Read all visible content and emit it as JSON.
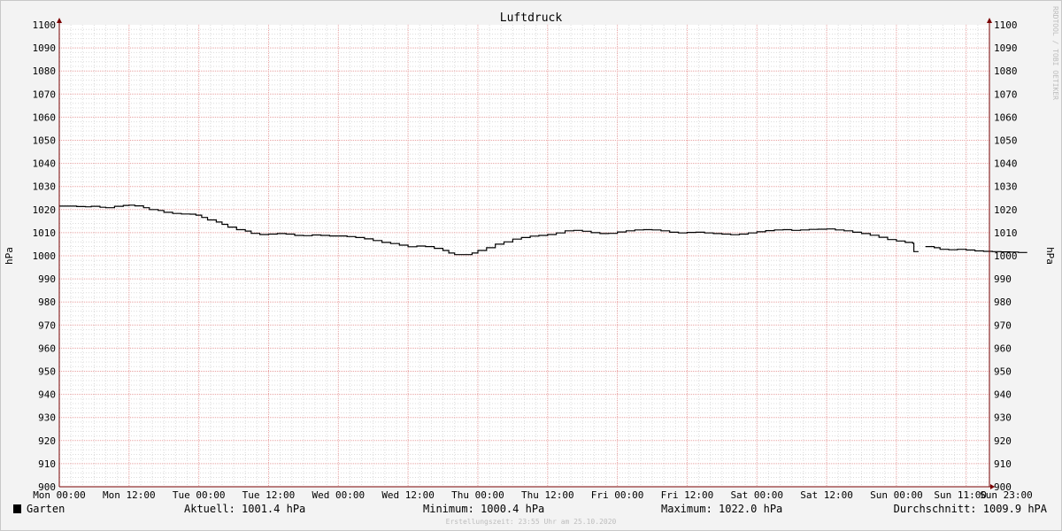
{
  "chart_data": {
    "type": "line",
    "title": "Luftdruck",
    "ylabel_left": "hPa",
    "ylabel_right": "hPa",
    "ylim": [
      900,
      1100
    ],
    "ytick_step": 10,
    "xlim_hours": [
      0,
      160
    ],
    "xticks": [
      {
        "h": 0,
        "label": "Mon 00:00"
      },
      {
        "h": 12,
        "label": "Mon 12:00"
      },
      {
        "h": 24,
        "label": "Tue 00:00"
      },
      {
        "h": 36,
        "label": "Tue 12:00"
      },
      {
        "h": 48,
        "label": "Wed 00:00"
      },
      {
        "h": 60,
        "label": "Wed 12:00"
      },
      {
        "h": 72,
        "label": "Thu 00:00"
      },
      {
        "h": 84,
        "label": "Thu 12:00"
      },
      {
        "h": 96,
        "label": "Fri 00:00"
      },
      {
        "h": 108,
        "label": "Fri 12:00"
      },
      {
        "h": 120,
        "label": "Sat 00:00"
      },
      {
        "h": 132,
        "label": "Sat 12:00"
      },
      {
        "h": 144,
        "label": "Sun 00:00"
      },
      {
        "h": 155,
        "label": "Sun 11:00"
      },
      {
        "h": 167,
        "label": "Sun 23:00"
      }
    ],
    "grid": true,
    "series": [
      {
        "name": "Garten",
        "color": "#000000",
        "segments": [
          [
            [
              0,
              1021.5
            ],
            [
              1.5,
              1021.5
            ],
            [
              3,
              1021.3
            ],
            [
              4.5,
              1021.2
            ],
            [
              5.5,
              1021.4
            ],
            [
              7,
              1021.0
            ],
            [
              8,
              1020.8
            ],
            [
              9.5,
              1021.4
            ],
            [
              11,
              1021.8
            ],
            [
              12,
              1021.9
            ],
            [
              13,
              1021.6
            ],
            [
              14.5,
              1020.8
            ],
            [
              15.5,
              1020.0
            ],
            [
              17,
              1019.6
            ],
            [
              18,
              1018.8
            ],
            [
              19.5,
              1018.3
            ],
            [
              21,
              1018.1
            ],
            [
              22.5,
              1018.0
            ],
            [
              23.5,
              1017.6
            ],
            [
              24.5,
              1016.6
            ],
            [
              25.5,
              1015.5
            ],
            [
              27,
              1014.6
            ],
            [
              28,
              1013.6
            ],
            [
              29,
              1012.4
            ],
            [
              30.5,
              1011.3
            ],
            [
              32,
              1010.7
            ],
            [
              33,
              1009.7
            ],
            [
              34.5,
              1009.2
            ],
            [
              36,
              1009.4
            ],
            [
              37.5,
              1009.6
            ],
            [
              39,
              1009.4
            ],
            [
              40.5,
              1008.8
            ],
            [
              42,
              1008.7
            ],
            [
              43.5,
              1009.0
            ],
            [
              45,
              1008.8
            ],
            [
              46.5,
              1008.6
            ],
            [
              48,
              1008.6
            ],
            [
              49.5,
              1008.3
            ],
            [
              51,
              1007.9
            ],
            [
              52.5,
              1007.3
            ],
            [
              54,
              1006.6
            ],
            [
              55.5,
              1005.8
            ],
            [
              57,
              1005.3
            ],
            [
              58.5,
              1004.6
            ],
            [
              60,
              1003.9
            ],
            [
              61.5,
              1004.2
            ],
            [
              63,
              1004.0
            ],
            [
              64.5,
              1003.2
            ],
            [
              66,
              1002.3
            ],
            [
              67,
              1001.2
            ],
            [
              68,
              1000.5
            ],
            [
              69.5,
              1000.5
            ],
            [
              71,
              1001.2
            ],
            [
              72,
              1002.3
            ],
            [
              73.5,
              1003.5
            ],
            [
              75,
              1005.0
            ],
            [
              76.5,
              1006.0
            ],
            [
              78,
              1007.2
            ],
            [
              79.5,
              1007.9
            ],
            [
              81,
              1008.5
            ],
            [
              82.5,
              1008.8
            ],
            [
              84,
              1009.2
            ],
            [
              85.5,
              1009.9
            ],
            [
              87,
              1010.8
            ],
            [
              88.5,
              1011.0
            ],
            [
              90,
              1010.6
            ],
            [
              91.5,
              1010.0
            ],
            [
              93,
              1009.6
            ],
            [
              94.5,
              1009.7
            ],
            [
              96,
              1010.3
            ],
            [
              97.5,
              1010.8
            ],
            [
              99,
              1011.2
            ],
            [
              100.5,
              1011.3
            ],
            [
              102,
              1011.2
            ],
            [
              103.5,
              1010.8
            ],
            [
              105,
              1010.2
            ],
            [
              106.5,
              1009.9
            ],
            [
              108,
              1010.1
            ],
            [
              109.5,
              1010.2
            ],
            [
              111,
              1009.9
            ],
            [
              112.5,
              1009.6
            ],
            [
              114,
              1009.4
            ],
            [
              115.5,
              1009.1
            ],
            [
              117,
              1009.4
            ],
            [
              118.5,
              1009.9
            ],
            [
              120,
              1010.4
            ],
            [
              121.5,
              1010.9
            ],
            [
              123,
              1011.2
            ],
            [
              124.5,
              1011.3
            ],
            [
              126,
              1011.0
            ],
            [
              127.5,
              1011.2
            ],
            [
              129,
              1011.4
            ],
            [
              130.5,
              1011.5
            ],
            [
              132,
              1011.6
            ],
            [
              133.5,
              1011.2
            ],
            [
              135,
              1010.8
            ],
            [
              136.5,
              1010.2
            ],
            [
              138,
              1009.6
            ],
            [
              139.5,
              1008.9
            ],
            [
              141,
              1008.0
            ],
            [
              142.5,
              1007.0
            ],
            [
              144,
              1006.4
            ],
            [
              145.5,
              1005.8
            ],
            [
              146.8,
              1005.4
            ],
            [
              147,
              1001.8
            ],
            [
              147.8,
              1001.8
            ]
          ],
          [
            [
              149,
              1004.0
            ],
            [
              150.5,
              1003.5
            ],
            [
              151.5,
              1002.8
            ],
            [
              153,
              1002.6
            ],
            [
              154.5,
              1002.8
            ],
            [
              156,
              1002.5
            ],
            [
              157.5,
              1002.1
            ],
            [
              159,
              1001.9
            ],
            [
              160.5,
              1001.8
            ],
            [
              162,
              1001.7
            ],
            [
              163.5,
              1001.6
            ],
            [
              165,
              1001.4
            ],
            [
              166.5,
              1001.4
            ]
          ]
        ]
      }
    ]
  },
  "watermark": "RRDTOOL / TOBI OETIKER",
  "legend": {
    "series_name": "Garten",
    "swatch_color": "#000000",
    "current": "Aktuell: 1001.4 hPa",
    "minimum": "Minimum: 1000.4 hPa",
    "maximum": "Maximum: 1022.0 hPa",
    "average": "Durchschnitt: 1009.9 hPA"
  },
  "created": "Erstellungszeit: 23:55 Uhr am 25.10.2020",
  "colors": {
    "background": "#f3f3f3",
    "plot_background": "#ffffff",
    "grid_minor": "#dcdcdc",
    "grid_major": "#e8a0a0",
    "axis": "#7a0000",
    "line": "#000000"
  }
}
